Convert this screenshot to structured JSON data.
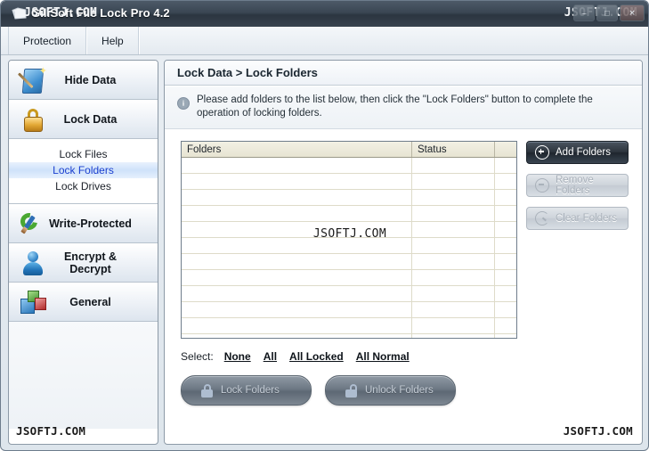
{
  "window": {
    "title": "GiliSoft File Lock Pro 4.2",
    "icon": "app-folder-icon",
    "watermark": "JSOFTJ.COM",
    "buttons": {
      "minimize": "–",
      "maximize": "□",
      "close": "✕"
    }
  },
  "menubar": {
    "items": [
      {
        "label": "Protection",
        "accel": "P"
      },
      {
        "label": "Help",
        "accel": "H"
      }
    ]
  },
  "sidebar": {
    "groups": [
      {
        "label": "Hide Data",
        "icon": "wand-icon"
      },
      {
        "label": "Lock Data",
        "icon": "padlock-icon"
      }
    ],
    "sub_items": [
      {
        "label": "Lock Files",
        "selected": false
      },
      {
        "label": "Lock Folders",
        "selected": true
      },
      {
        "label": "Lock Drives",
        "selected": false
      }
    ],
    "groups_lower": [
      {
        "label": "Write-Protected",
        "icon": "pencil-circle-icon"
      },
      {
        "label": "Encrypt & Decrypt",
        "icon": "user-icon"
      },
      {
        "label": "General",
        "icon": "blocks-icon"
      }
    ],
    "watermark": "JSOFTJ.COM"
  },
  "main": {
    "breadcrumb": "Lock Data > Lock Folders",
    "info_icon": "info-icon",
    "info_text": "Please add folders to the list below, then click the \"Lock Folders\" button to complete the operation of locking folders.",
    "table": {
      "columns": [
        "Folders",
        "Status",
        ""
      ],
      "rows": [],
      "empty_row_count": 12,
      "watermark": "JSOFTJ.COM"
    },
    "actions": [
      {
        "label": "Add Folders",
        "icon": "plus-circle-icon",
        "state": "enabled"
      },
      {
        "label": "Remove Folders",
        "icon": "minus-circle-icon",
        "state": "disabled"
      },
      {
        "label": "Clear Folders",
        "icon": "refresh-circle-icon",
        "state": "disabled"
      }
    ],
    "select": {
      "label": "Select:",
      "links": [
        "None",
        "All",
        "All Locked",
        "All Normal"
      ]
    },
    "pills": [
      {
        "label": "Lock Folders",
        "icon": "lock-closed-icon",
        "state": "disabled"
      },
      {
        "label": "Unlock Folders",
        "icon": "lock-open-icon",
        "state": "disabled"
      }
    ],
    "watermark": "JSOFTJ.COM"
  },
  "colors": {
    "titlebar": "#3a4653",
    "selection": "#cfe2fa",
    "selection_text": "#1a3fcf",
    "table_header": "#e7e4d2",
    "primary_button": "#2c343d"
  }
}
